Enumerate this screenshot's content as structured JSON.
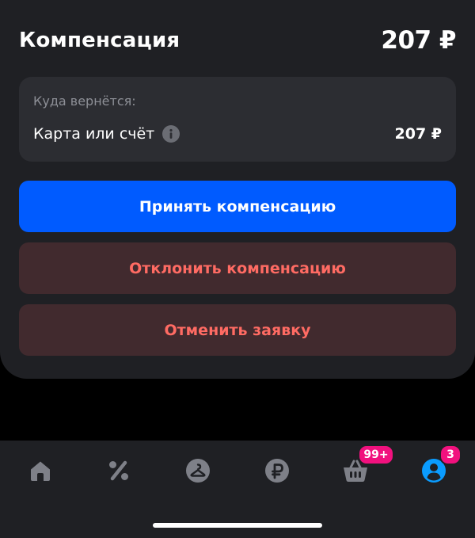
{
  "compensation": {
    "title": "Компенсация",
    "amount": "207 ₽"
  },
  "refund": {
    "caption": "Куда вернётся:",
    "destination_label": "Карта или счёт",
    "info_icon": "info-icon",
    "amount": "207 ₽"
  },
  "actions": {
    "accept_label": "Принять компенсацию",
    "decline_label": "Отклонить компенсацию",
    "cancel_label": "Отменить заявку"
  },
  "tabbar": {
    "items": [
      {
        "icon": "home-icon",
        "active": false
      },
      {
        "icon": "percent-icon",
        "active": false
      },
      {
        "icon": "hanger-icon",
        "active": false
      },
      {
        "icon": "ruble-icon",
        "active": false
      },
      {
        "icon": "basket-icon",
        "active": false,
        "badge": "99+"
      },
      {
        "icon": "profile-icon",
        "active": true,
        "badge": "3"
      }
    ]
  },
  "colors": {
    "accent": "#005bff",
    "danger_text": "#ff6b63",
    "badge": "#f1117e",
    "active_tab": "#0a9cff"
  }
}
